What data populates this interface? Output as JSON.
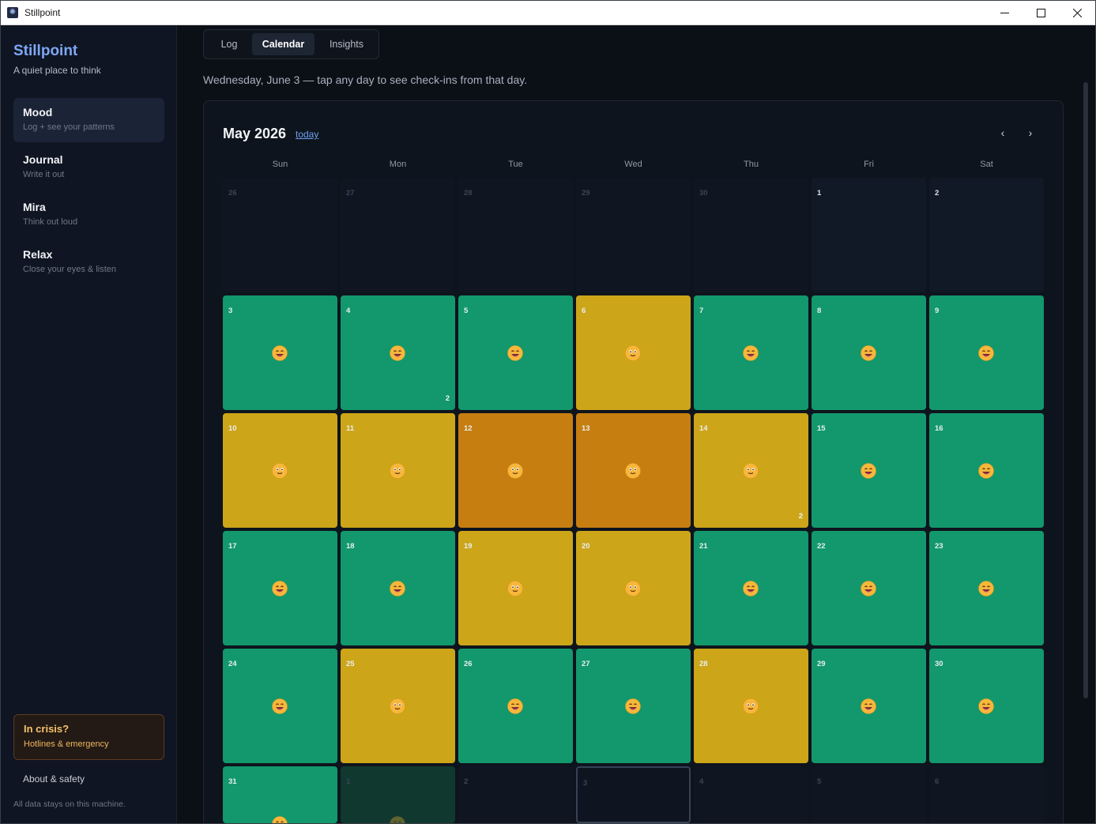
{
  "window": {
    "title": "Stillpoint"
  },
  "sidebar": {
    "brand": "Stillpoint",
    "tagline": "A quiet place to think",
    "items": [
      {
        "title": "Mood",
        "subtitle": "Log + see your patterns",
        "active": true
      },
      {
        "title": "Journal",
        "subtitle": "Write it out"
      },
      {
        "title": "Mira",
        "subtitle": "Think out loud"
      },
      {
        "title": "Relax",
        "subtitle": "Close your eyes & listen"
      }
    ],
    "crisis": {
      "title": "In crisis?",
      "subtitle": "Hotlines & emergency"
    },
    "about": "About & safety",
    "footnote": "All data stays on this machine."
  },
  "main": {
    "tabs": [
      {
        "label": "Log"
      },
      {
        "label": "Calendar",
        "active": true
      },
      {
        "label": "Insights"
      }
    ],
    "subtitle": "Wednesday, June 3 — tap any day to see check-ins from that day.",
    "calendar": {
      "month_title": "May 2026",
      "today_link": "today",
      "prev_icon": "chevron-left-icon",
      "next_icon": "chevron-right-icon",
      "weekdays": [
        "Sun",
        "Mon",
        "Tue",
        "Wed",
        "Thu",
        "Fri",
        "Sat"
      ],
      "mood_colors": {
        "great": "#12986c",
        "okay": "#cca519",
        "low": "#c67e10"
      },
      "weeks": [
        [
          {
            "day": "26",
            "outside": true
          },
          {
            "day": "27",
            "outside": true
          },
          {
            "day": "28",
            "outside": true
          },
          {
            "day": "29",
            "outside": true
          },
          {
            "day": "30",
            "outside": true
          },
          {
            "day": "1"
          },
          {
            "day": "2"
          }
        ],
        [
          {
            "day": "3",
            "mood": "great"
          },
          {
            "day": "4",
            "mood": "great",
            "count": "2"
          },
          {
            "day": "5",
            "mood": "great"
          },
          {
            "day": "6",
            "mood": "okay"
          },
          {
            "day": "7",
            "mood": "great"
          },
          {
            "day": "8",
            "mood": "great"
          },
          {
            "day": "9",
            "mood": "great"
          }
        ],
        [
          {
            "day": "10",
            "mood": "okay"
          },
          {
            "day": "11",
            "mood": "okay"
          },
          {
            "day": "12",
            "mood": "low"
          },
          {
            "day": "13",
            "mood": "low"
          },
          {
            "day": "14",
            "mood": "okay",
            "count": "2"
          },
          {
            "day": "15",
            "mood": "great"
          },
          {
            "day": "16",
            "mood": "great"
          }
        ],
        [
          {
            "day": "17",
            "mood": "great"
          },
          {
            "day": "18",
            "mood": "great"
          },
          {
            "day": "19",
            "mood": "okay"
          },
          {
            "day": "20",
            "mood": "okay"
          },
          {
            "day": "21",
            "mood": "great"
          },
          {
            "day": "22",
            "mood": "great"
          },
          {
            "day": "23",
            "mood": "great"
          }
        ],
        [
          {
            "day": "24",
            "mood": "great"
          },
          {
            "day": "25",
            "mood": "okay"
          },
          {
            "day": "26",
            "mood": "great"
          },
          {
            "day": "27",
            "mood": "great"
          },
          {
            "day": "28",
            "mood": "okay"
          },
          {
            "day": "29",
            "mood": "great"
          },
          {
            "day": "30",
            "mood": "great"
          }
        ],
        [
          {
            "day": "31",
            "mood": "great"
          },
          {
            "day": "1",
            "outside": true,
            "mood": "great"
          },
          {
            "day": "2",
            "outside": true
          },
          {
            "day": "3",
            "outside": true,
            "today": true
          },
          {
            "day": "4",
            "outside": true
          },
          {
            "day": "5",
            "outside": true
          },
          {
            "day": "6",
            "outside": true
          }
        ]
      ]
    }
  }
}
